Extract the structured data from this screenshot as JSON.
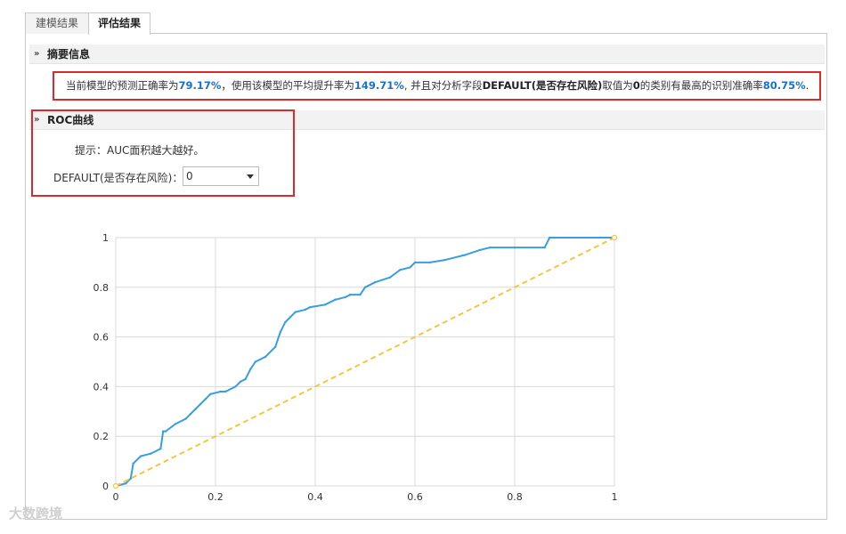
{
  "tabs": [
    {
      "label": "建模结果",
      "active": false
    },
    {
      "label": "评估结果",
      "active": true
    }
  ],
  "summary": {
    "header": "摘要信息",
    "text_1": "当前模型的预测正确率为",
    "accuracy": "79.17%",
    "text_2": "，使用该模型的平均提升率为",
    "lift": "149.71%",
    "text_3": ", 并且对分析字段",
    "field": "DEFAULT(是否存在风险)",
    "text_4": "取值为",
    "class_value": "0",
    "text_5": "的类别有最高的识别准确率",
    "class_accuracy": "80.75%",
    "text_6": "."
  },
  "roc": {
    "header": "ROC曲线",
    "hint": "提示：AUC面积越大越好。",
    "select_label": "DEFAULT(是否存在风险)：",
    "select_value": "0"
  },
  "watermark": "大数跨境",
  "colors": {
    "roc_line": "#3a9de0",
    "diagonal": "#f5c542",
    "highlight_border": "#d92b2b",
    "value_blue": "#1a6fd0"
  },
  "chart_data": {
    "type": "line",
    "title": "",
    "xlabel": "",
    "ylabel": "",
    "xlim": [
      0,
      1
    ],
    "ylim": [
      0,
      1
    ],
    "x_ticks": [
      "0",
      "0.2",
      "0.4",
      "0.6",
      "0.8",
      "1"
    ],
    "y_ticks": [
      "0",
      "0.2",
      "0.4",
      "0.6",
      "0.8",
      "1"
    ],
    "grid": true,
    "series": [
      {
        "style": "solid",
        "x": [
          0,
          0.02,
          0.03,
          0.035,
          0.05,
          0.07,
          0.09,
          0.095,
          0.1,
          0.12,
          0.14,
          0.15,
          0.16,
          0.17,
          0.18,
          0.19,
          0.21,
          0.22,
          0.24,
          0.25,
          0.26,
          0.27,
          0.28,
          0.3,
          0.32,
          0.33,
          0.34,
          0.35,
          0.36,
          0.38,
          0.39,
          0.42,
          0.44,
          0.46,
          0.47,
          0.49,
          0.5,
          0.52,
          0.55,
          0.57,
          0.59,
          0.6,
          0.63,
          0.66,
          0.7,
          0.73,
          0.75,
          0.8,
          0.86,
          0.87,
          1.0
        ],
        "y": [
          0,
          0.01,
          0.03,
          0.09,
          0.12,
          0.13,
          0.15,
          0.22,
          0.22,
          0.25,
          0.27,
          0.29,
          0.31,
          0.33,
          0.35,
          0.37,
          0.38,
          0.38,
          0.4,
          0.42,
          0.43,
          0.47,
          0.5,
          0.52,
          0.56,
          0.62,
          0.66,
          0.68,
          0.7,
          0.71,
          0.72,
          0.73,
          0.75,
          0.76,
          0.77,
          0.77,
          0.8,
          0.82,
          0.84,
          0.87,
          0.88,
          0.9,
          0.9,
          0.91,
          0.93,
          0.95,
          0.96,
          0.96,
          0.96,
          1.0,
          1.0
        ]
      },
      {
        "style": "dashed",
        "x": [
          0,
          1
        ],
        "y": [
          0,
          1
        ]
      }
    ]
  }
}
